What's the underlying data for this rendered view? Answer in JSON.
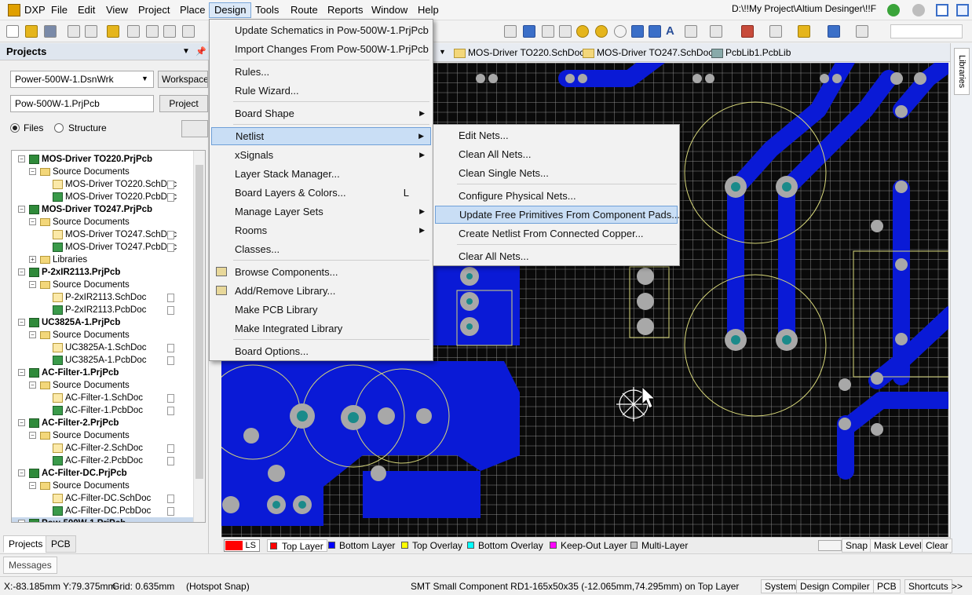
{
  "menubar": {
    "app": "DXP",
    "items": [
      "File",
      "Edit",
      "View",
      "Project",
      "Place",
      "Design",
      "Tools",
      "Route",
      "Reports",
      "Window",
      "Help"
    ],
    "path": "D:\\!!My Project\\Altium Desinger\\!!F"
  },
  "projects_panel": {
    "title": "Projects",
    "workspace_combo": "Power-500W-1.DsnWrk",
    "workspace_btn": "Workspace",
    "project_field": "Pow-500W-1.PrjPcb",
    "project_btn": "Project",
    "radio_files": "Files",
    "radio_structure": "Structure",
    "tree": [
      {
        "level": 0,
        "type": "prj",
        "label": "MOS-Driver TO220.PrjPcb",
        "bold": true,
        "toggle": "−"
      },
      {
        "level": 1,
        "type": "fold",
        "label": "Source Documents",
        "toggle": "−"
      },
      {
        "level": 2,
        "type": "sch",
        "label": "MOS-Driver TO220.SchDoc"
      },
      {
        "level": 2,
        "type": "pcb",
        "label": "MOS-Driver TO220.PcbDoc"
      },
      {
        "level": 0,
        "type": "prj",
        "label": "MOS-Driver TO247.PrjPcb",
        "bold": true,
        "toggle": "−"
      },
      {
        "level": 1,
        "type": "fold",
        "label": "Source Documents",
        "toggle": "−"
      },
      {
        "level": 2,
        "type": "sch",
        "label": "MOS-Driver TO247.SchDoc"
      },
      {
        "level": 2,
        "type": "pcb",
        "label": "MOS-Driver TO247.PcbDoc"
      },
      {
        "level": 1,
        "type": "fold",
        "label": "Libraries",
        "toggle": "+"
      },
      {
        "level": 0,
        "type": "prj",
        "label": "P-2xIR2113.PrjPcb",
        "bold": true,
        "toggle": "−"
      },
      {
        "level": 1,
        "type": "fold",
        "label": "Source Documents",
        "toggle": "−"
      },
      {
        "level": 2,
        "type": "sch",
        "label": "P-2xIR2113.SchDoc"
      },
      {
        "level": 2,
        "type": "pcb",
        "label": "P-2xIR2113.PcbDoc"
      },
      {
        "level": 0,
        "type": "prj",
        "label": "UC3825A-1.PrjPcb",
        "bold": true,
        "toggle": "−"
      },
      {
        "level": 1,
        "type": "fold",
        "label": "Source Documents",
        "toggle": "−"
      },
      {
        "level": 2,
        "type": "sch",
        "label": "UC3825A-1.SchDoc"
      },
      {
        "level": 2,
        "type": "pcb",
        "label": "UC3825A-1.PcbDoc"
      },
      {
        "level": 0,
        "type": "prj",
        "label": "AC-Filter-1.PrjPcb",
        "bold": true,
        "toggle": "−"
      },
      {
        "level": 1,
        "type": "fold",
        "label": "Source Documents",
        "toggle": "−"
      },
      {
        "level": 2,
        "type": "sch",
        "label": "AC-Filter-1.SchDoc"
      },
      {
        "level": 2,
        "type": "pcb",
        "label": "AC-Filter-1.PcbDoc"
      },
      {
        "level": 0,
        "type": "prj",
        "label": "AC-Filter-2.PrjPcb",
        "bold": true,
        "toggle": "−"
      },
      {
        "level": 1,
        "type": "fold",
        "label": "Source Documents",
        "toggle": "−"
      },
      {
        "level": 2,
        "type": "sch",
        "label": "AC-Filter-2.SchDoc"
      },
      {
        "level": 2,
        "type": "pcb",
        "label": "AC-Filter-2.PcbDoc"
      },
      {
        "level": 0,
        "type": "prj",
        "label": "AC-Filter-DC.PrjPcb",
        "bold": true,
        "toggle": "−"
      },
      {
        "level": 1,
        "type": "fold",
        "label": "Source Documents",
        "toggle": "−"
      },
      {
        "level": 2,
        "type": "sch",
        "label": "AC-Filter-DC.SchDoc"
      },
      {
        "level": 2,
        "type": "pcb",
        "label": "AC-Filter-DC.PcbDoc"
      },
      {
        "level": 0,
        "type": "prj",
        "label": "Pow-500W-1.PrjPcb",
        "bold": true,
        "toggle": "−"
      }
    ],
    "tabs": [
      "Projects",
      "PCB"
    ]
  },
  "doc_tabs": [
    "MOS-Driver TO220.SchDoc",
    "MOS-Driver TO247.SchDoc",
    "PcbLib1.PcbLib"
  ],
  "right_strip": {
    "libraries": "Libraries"
  },
  "design_menu": {
    "items": [
      {
        "label": "Update Schematics in Pow-500W-1.PrjPcb"
      },
      {
        "label": "Import Changes From Pow-500W-1.PrjPcb"
      },
      {
        "label": "Rules..."
      },
      {
        "label": "Rule Wizard..."
      },
      {
        "label": "Board Shape",
        "sub": true
      },
      {
        "label": "Netlist",
        "sub": true,
        "highlighted": true
      },
      {
        "label": "xSignals",
        "sub": true
      },
      {
        "label": "Layer Stack Manager..."
      },
      {
        "label": "Board Layers & Colors...",
        "shortcut": "L"
      },
      {
        "label": "Manage Layer Sets",
        "sub": true
      },
      {
        "label": "Rooms",
        "sub": true
      },
      {
        "label": "Classes..."
      },
      {
        "label": "Browse Components..."
      },
      {
        "label": "Add/Remove Library..."
      },
      {
        "label": "Make PCB Library"
      },
      {
        "label": "Make Integrated Library"
      },
      {
        "label": "Board Options..."
      }
    ]
  },
  "netlist_menu": {
    "items": [
      {
        "label": "Edit Nets..."
      },
      {
        "label": "Clean All Nets..."
      },
      {
        "label": "Clean Single Nets..."
      },
      {
        "label": "Configure Physical Nets..."
      },
      {
        "label": "Update Free Primitives From Component Pads...",
        "highlighted": true
      },
      {
        "label": "Create Netlist From Connected Copper..."
      },
      {
        "label": "Clear All Nets..."
      }
    ]
  },
  "layer_bar": {
    "ls": "LS",
    "layers": [
      {
        "name": "Top Layer",
        "color": "#ff0000",
        "active": true
      },
      {
        "name": "Bottom Layer",
        "color": "#0000ff"
      },
      {
        "name": "Top Overlay",
        "color": "#ffff00"
      },
      {
        "name": "Bottom Overlay",
        "color": "#00ffff"
      },
      {
        "name": "Keep-Out Layer",
        "color": "#ff00ff"
      },
      {
        "name": "Multi-Layer",
        "color": "#c0c0c0"
      }
    ],
    "right_buttons": [
      "Snap",
      "Mask Level",
      "Clear"
    ]
  },
  "messages_tab": "Messages",
  "statusbar": {
    "coords": "X:-83.185mm Y:79.375mm",
    "grid": "Grid: 0.635mm",
    "snap": "(Hotspot Snap)",
    "info": "SMT Small Component RD1-165x50x35 (-12.065mm,74.295mm) on Top Layer",
    "buttons": [
      "System",
      "Design Compiler",
      "PCB",
      "Shortcuts"
    ],
    "more": ">>"
  },
  "colors": {
    "copper": "#0a1ad6",
    "pad": "#a8a8a8",
    "hole": "#1a8a8a",
    "overlay": "#d8d87a",
    "grid": "#969696"
  }
}
